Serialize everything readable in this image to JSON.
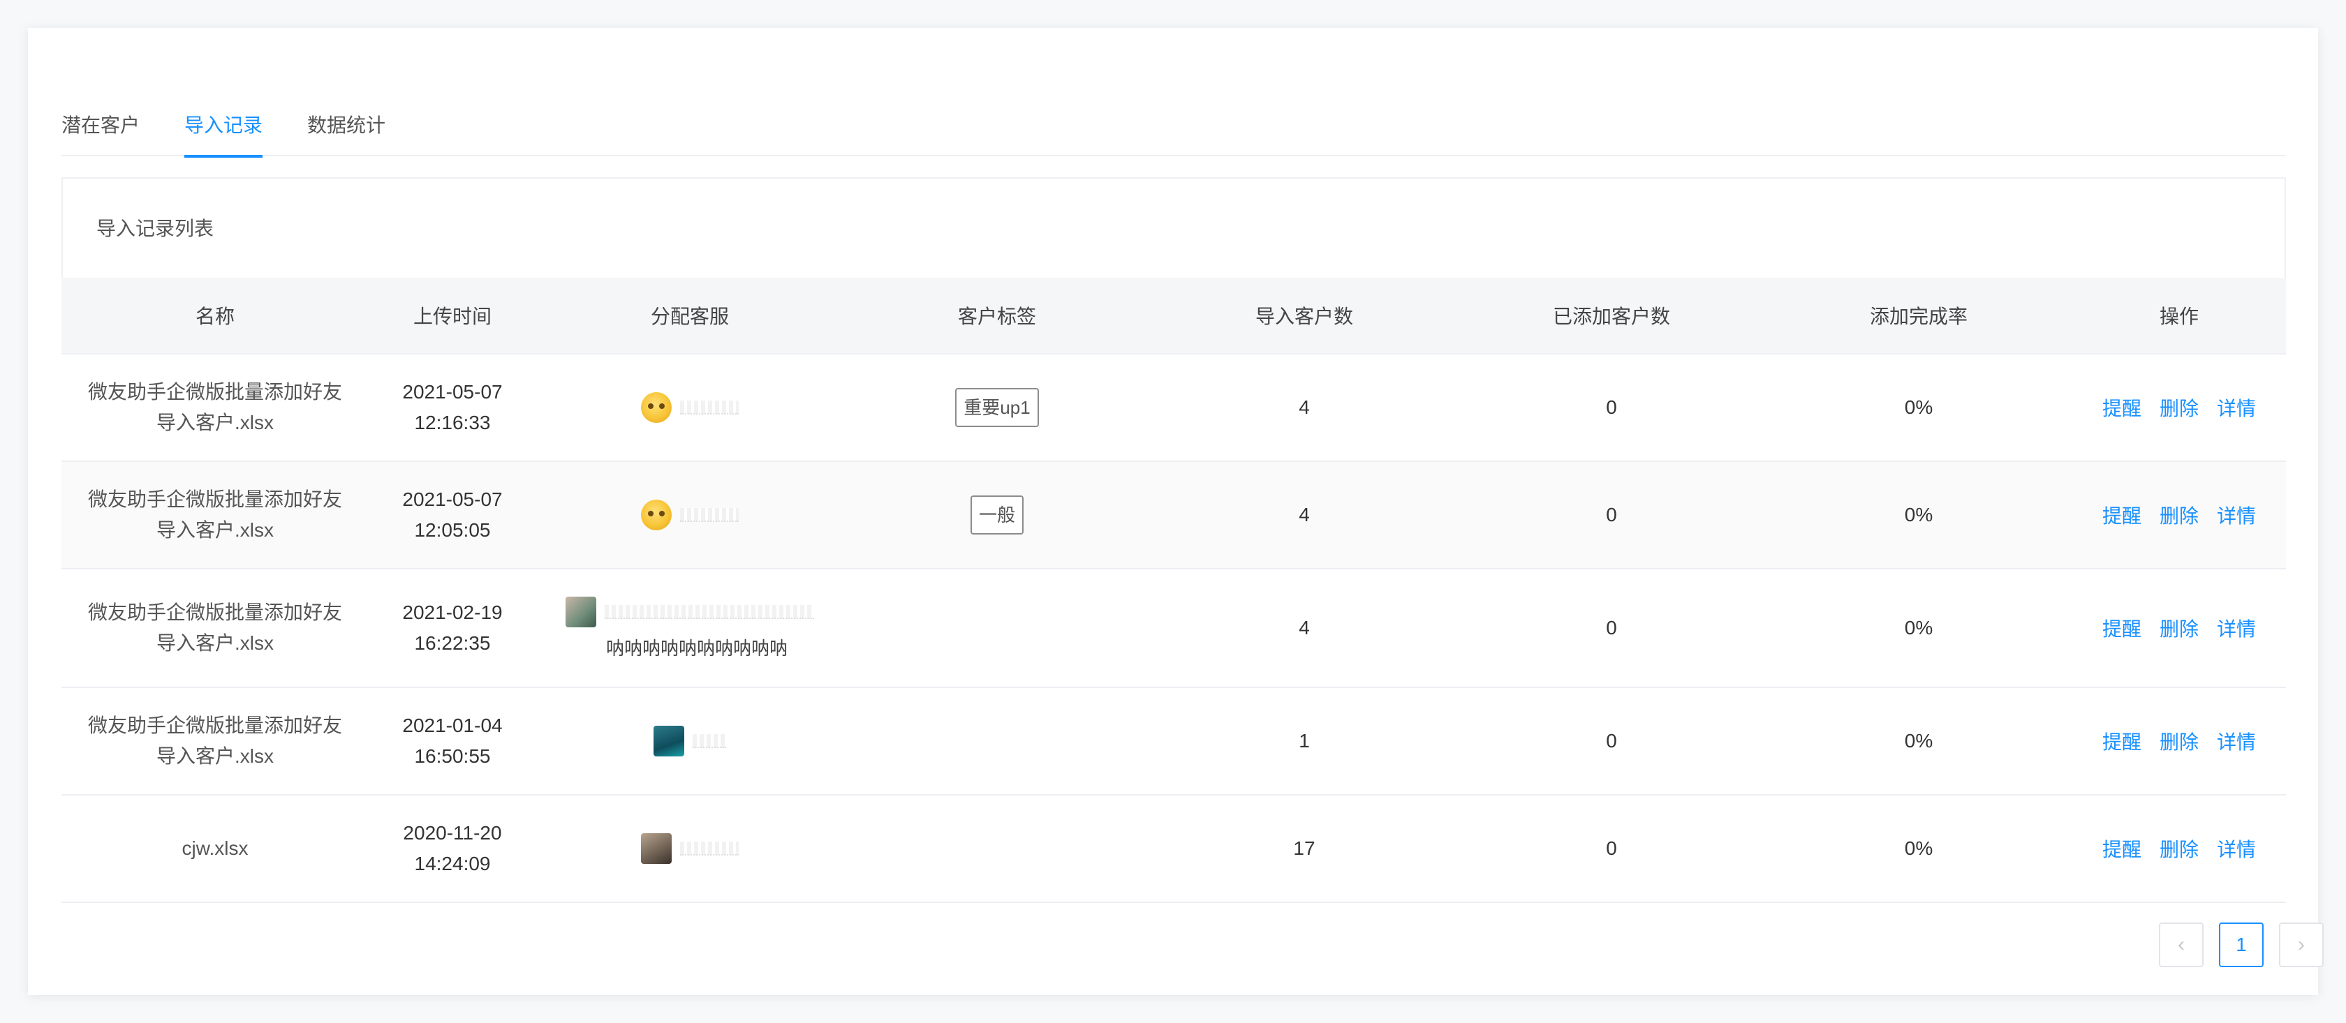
{
  "tabs": [
    {
      "label": "潜在客户",
      "active": false
    },
    {
      "label": "导入记录",
      "active": true
    },
    {
      "label": "数据统计",
      "active": false
    }
  ],
  "panel": {
    "title": "导入记录列表"
  },
  "table": {
    "headers": [
      "名称",
      "上传时间",
      "分配客服",
      "客户标签",
      "导入客户数",
      "已添加客户数",
      "添加完成率",
      "操作"
    ],
    "rows": [
      {
        "name_line1": "微友助手企微版批量添加好友",
        "name_line2": "导入客户.xlsx",
        "date": "2021-05-07",
        "time": "12:16:33",
        "agent_extra": "",
        "tag": "重要up1",
        "imported": "4",
        "added": "0",
        "rate": "0%"
      },
      {
        "name_line1": "微友助手企微版批量添加好友",
        "name_line2": "导入客户.xlsx",
        "date": "2021-05-07",
        "time": "12:05:05",
        "agent_extra": "",
        "tag": "一般",
        "imported": "4",
        "added": "0",
        "rate": "0%"
      },
      {
        "name_line1": "微友助手企微版批量添加好友",
        "name_line2": "导入客户.xlsx",
        "date": "2021-02-19",
        "time": "16:22:35",
        "agent_extra": "呐呐呐呐呐呐呐呐呐呐",
        "tag": "",
        "imported": "4",
        "added": "0",
        "rate": "0%"
      },
      {
        "name_line1": "微友助手企微版批量添加好友",
        "name_line2": "导入客户.xlsx",
        "date": "2021-01-04",
        "time": "16:50:55",
        "agent_extra": "",
        "tag": "",
        "imported": "1",
        "added": "0",
        "rate": "0%"
      },
      {
        "name_line1": "cjw.xlsx",
        "name_line2": "",
        "date": "2020-11-20",
        "time": "14:24:09",
        "agent_extra": "",
        "tag": "",
        "imported": "17",
        "added": "0",
        "rate": "0%"
      }
    ],
    "actions": {
      "remind": "提醒",
      "delete": "删除",
      "detail": "详情"
    }
  },
  "pagination": {
    "prev_icon": "‹",
    "current_page": "1",
    "next_icon": "›"
  },
  "colors": {
    "accent": "#1890ff"
  }
}
